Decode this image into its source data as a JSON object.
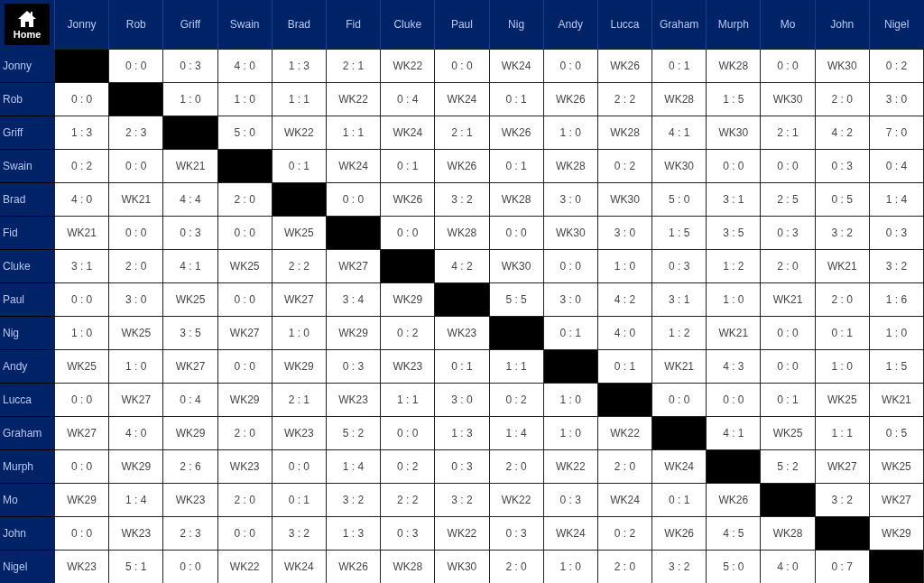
{
  "home_button": {
    "label": "Home"
  },
  "columns": [
    "Jonny",
    "Rob",
    "Griff",
    "Swain",
    "Brad",
    "Fid",
    "Cluke",
    "Paul",
    "Nig",
    "Andy",
    "Lucca",
    "Graham",
    "Murph",
    "Mo",
    "John",
    "Nigel"
  ],
  "rows": [
    {
      "name": "Jonny",
      "cells": [
        {
          "kind": "blocked"
        },
        "0 : 0",
        "0 : 3",
        "4 : 0",
        "1 : 3",
        "2 : 1",
        "WK22",
        "0 : 0",
        "WK24",
        "0 : 0",
        "WK26",
        "0 : 1",
        "WK28",
        "0 : 0",
        "WK30",
        "0 : 2"
      ]
    },
    {
      "name": "Rob",
      "cells": [
        "0 : 0",
        {
          "kind": "blocked"
        },
        "1 : 0",
        "1 : 0",
        "1 : 1",
        "WK22",
        "0 : 4",
        "WK24",
        "0 : 1",
        "WK26",
        "2 : 2",
        "WK28",
        "1 : 5",
        "WK30",
        "2 : 0",
        "3 : 0"
      ]
    },
    {
      "name": "Griff",
      "cells": [
        "1 : 3",
        "2 : 3",
        {
          "kind": "blocked"
        },
        "5 : 0",
        "WK22",
        "1 : 1",
        "WK24",
        "2 : 1",
        "WK26",
        "1 : 0",
        "WK28",
        "4 : 1",
        "WK30",
        "2 : 1",
        "4 : 2",
        "7 : 0"
      ]
    },
    {
      "name": "Swain",
      "cells": [
        "0 : 2",
        "0 : 0",
        "WK21",
        {
          "kind": "blocked"
        },
        "0 : 1",
        "WK24",
        "0 : 1",
        "WK26",
        "0 : 1",
        "WK28",
        "0 : 2",
        "WK30",
        "0 : 0",
        "0 : 0",
        "0 : 3",
        "0 : 4"
      ]
    },
    {
      "name": "Brad",
      "cells": [
        "4 : 0",
        "WK21",
        "4 : 4",
        "2 : 0",
        {
          "kind": "blocked"
        },
        "0 : 0",
        "WK26",
        "3 : 2",
        "WK28",
        "3 : 0",
        "WK30",
        "5 : 0",
        "3 : 1",
        "2 : 5",
        "0 : 5",
        "1 : 4"
      ]
    },
    {
      "name": "Fid",
      "cells": [
        "WK21",
        "0 : 0",
        "0 : 3",
        "0 : 0",
        "WK25",
        {
          "kind": "blocked"
        },
        "0 : 0",
        "WK28",
        "0 : 0",
        "WK30",
        "3 : 0",
        "1 : 5",
        "3 : 5",
        "0 : 3",
        "3 : 2",
        "0 : 3"
      ]
    },
    {
      "name": "Cluke",
      "cells": [
        "3 : 1",
        "2 : 0",
        "4 : 1",
        "WK25",
        "2 : 2",
        "WK27",
        {
          "kind": "blocked"
        },
        "4 : 2",
        "WK30",
        "0 : 0",
        "1 : 0",
        "0 : 3",
        "1 : 2",
        "2 : 0",
        "WK21",
        "3 : 2"
      ]
    },
    {
      "name": "Paul",
      "cells": [
        "0 : 0",
        "3 : 0",
        "WK25",
        "0 : 0",
        "WK27",
        "3 : 4",
        "WK29",
        {
          "kind": "blocked"
        },
        "5 : 5",
        "3 : 0",
        "4 : 2",
        "3 : 1",
        "1 : 0",
        "WK21",
        "2 : 0",
        "1 : 6"
      ]
    },
    {
      "name": "Nig",
      "cells": [
        "1 : 0",
        "WK25",
        "3 : 5",
        "WK27",
        "1 : 0",
        "WK29",
        "0 : 2",
        "WK23",
        {
          "kind": "blocked"
        },
        "0 : 1",
        "4 : 0",
        "1 : 2",
        "WK21",
        "0 : 0",
        "0 : 1",
        "1 : 0"
      ]
    },
    {
      "name": "Andy",
      "cells": [
        "WK25",
        "1 : 0",
        "WK27",
        "0 : 0",
        "WK29",
        "0 : 3",
        "WK23",
        "0 : 1",
        "1 : 1",
        {
          "kind": "blocked"
        },
        "0 : 1",
        "WK21",
        "4 : 3",
        "0 : 0",
        "1 : 0",
        "1 : 5"
      ]
    },
    {
      "name": "Lucca",
      "cells": [
        "0 : 0",
        "WK27",
        "0 : 4",
        "WK29",
        "2 : 1",
        "WK23",
        "1 : 1",
        "3 : 0",
        "0 : 2",
        "1 : 0",
        {
          "kind": "blocked"
        },
        "0 : 0",
        "0 : 0",
        "0 : 1",
        "WK25",
        "WK21"
      ]
    },
    {
      "name": "Graham",
      "cells": [
        "WK27",
        "4 : 0",
        "WK29",
        "2 : 0",
        "WK23",
        "5 : 2",
        "0 : 0",
        "1 : 3",
        "1 : 4",
        "1 : 0",
        "WK22",
        {
          "kind": "blocked"
        },
        "4 : 1",
        "WK25",
        "1 : 1",
        "0 : 5"
      ]
    },
    {
      "name": "Murph",
      "cells": [
        "0 : 0",
        "WK29",
        "2 : 6",
        "WK23",
        "0 : 0",
        "1 : 4",
        "0 : 2",
        "0 : 3",
        "2 : 0",
        "WK22",
        "2 : 0",
        "WK24",
        {
          "kind": "blocked"
        },
        "5 : 2",
        "WK27",
        "WK25"
      ]
    },
    {
      "name": "Mo",
      "cells": [
        "WK29",
        "1 : 4",
        "WK23",
        "2 : 0",
        "0 : 1",
        "3 : 2",
        "2 : 2",
        "3 : 2",
        "WK22",
        "0 : 3",
        "WK24",
        "0 : 1",
        "WK26",
        {
          "kind": "blocked"
        },
        "3 : 2",
        "WK27"
      ]
    },
    {
      "name": "John",
      "cells": [
        "0 : 0",
        "WK23",
        "2 : 3",
        "0 : 0",
        "3 : 2",
        "1 : 3",
        "0 : 3",
        "WK22",
        "0 : 3",
        "WK24",
        "0 : 2",
        "WK26",
        "4 : 5",
        "WK28",
        {
          "kind": "blocked"
        },
        "WK29"
      ]
    },
    {
      "name": "Nigel",
      "cells": [
        "WK23",
        "5 : 1",
        "0 : 0",
        "WK22",
        "WK24",
        "WK26",
        "WK28",
        "WK30",
        "2 : 0",
        "1 : 0",
        "2 : 0",
        "3 : 2",
        "5 : 0",
        "4 : 0",
        "0 : 7",
        {
          "kind": "blocked"
        }
      ]
    }
  ]
}
